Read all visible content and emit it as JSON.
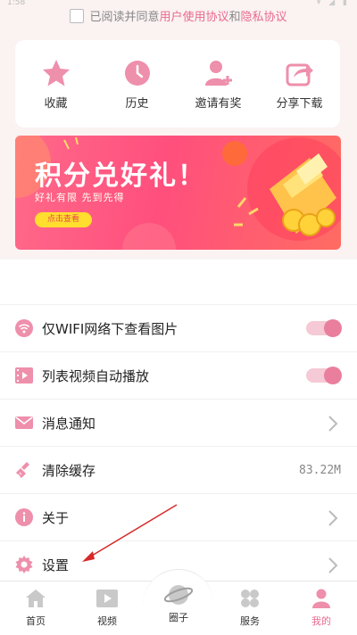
{
  "status_bar": {
    "time": "1:58",
    "icons": "▾ ◢ ▮"
  },
  "agreement": {
    "prefix": "已阅读并同意",
    "user_agreement": "用户使用协议",
    "connector": "和",
    "privacy_agreement": "隐私协议"
  },
  "quick_actions": [
    {
      "label": "收藏",
      "icon": "star-icon"
    },
    {
      "label": "历史",
      "icon": "clock-icon"
    },
    {
      "label": "邀请有奖",
      "icon": "add-user-icon"
    },
    {
      "label": "分享下载",
      "icon": "share-icon"
    }
  ],
  "banner": {
    "title": "积分兑好礼！",
    "subtitle": "好礼有限  先到先得",
    "button": "点击查看"
  },
  "settings": [
    {
      "label": "仅WIFI网络下查看图片",
      "icon": "wifi-icon",
      "type": "toggle",
      "on": true
    },
    {
      "label": "列表视频自动播放",
      "icon": "video-icon",
      "type": "toggle",
      "on": true
    },
    {
      "label": "消息通知",
      "icon": "mail-icon",
      "type": "link"
    },
    {
      "label": "清除缓存",
      "icon": "broom-icon",
      "type": "value",
      "value": "83.22M"
    },
    {
      "label": "关于",
      "icon": "info-icon",
      "type": "link"
    },
    {
      "label": "设置",
      "icon": "gear-icon",
      "type": "link"
    }
  ],
  "tabs": [
    {
      "label": "首页",
      "icon": "home-icon"
    },
    {
      "label": "视频",
      "icon": "play-icon"
    },
    {
      "label": "圈子",
      "icon": "planet-icon"
    },
    {
      "label": "服务",
      "icon": "grid-icon"
    },
    {
      "label": "我的",
      "icon": "person-icon",
      "active": true
    }
  ],
  "colors": {
    "accent": "#e86a8e",
    "icon_pink": "#ee8fab",
    "banner_red": "#ff4f7d",
    "toggle_on": "#ea7f9d"
  }
}
